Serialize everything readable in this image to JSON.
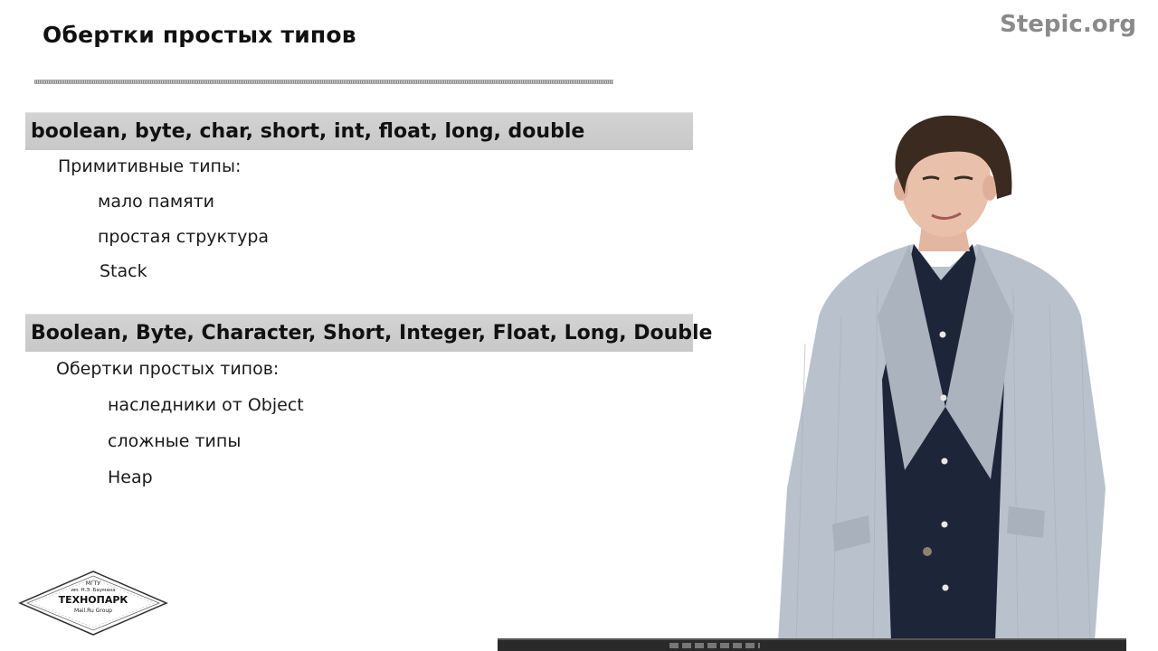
{
  "slide": {
    "title": "Обертки простых типов",
    "brand": "Stepic.org"
  },
  "section1": {
    "header": "boolean, byte, char, short, int, float, long, double",
    "subtitle": "Примитивные типы:",
    "items": [
      "мало памяти",
      "простая структура",
      "Stack"
    ]
  },
  "section2": {
    "header": "Boolean, Byte, Character, Short, Integer, Float, Long, Double",
    "subtitle": "Обертки простых типов:",
    "items": [
      "наследники от Object",
      "сложные типы",
      "Heap"
    ]
  },
  "logo": {
    "line1": "МГТУ",
    "line2": "им. Н.Э. Баумана",
    "line3": "ТЕХНОПАРК",
    "line4": "Mail.Ru Group"
  },
  "colors": {
    "band": "#cccccc",
    "brand": "#8a8a8a",
    "jacket": "#b9c2cc",
    "shirt": "#1d2538"
  }
}
